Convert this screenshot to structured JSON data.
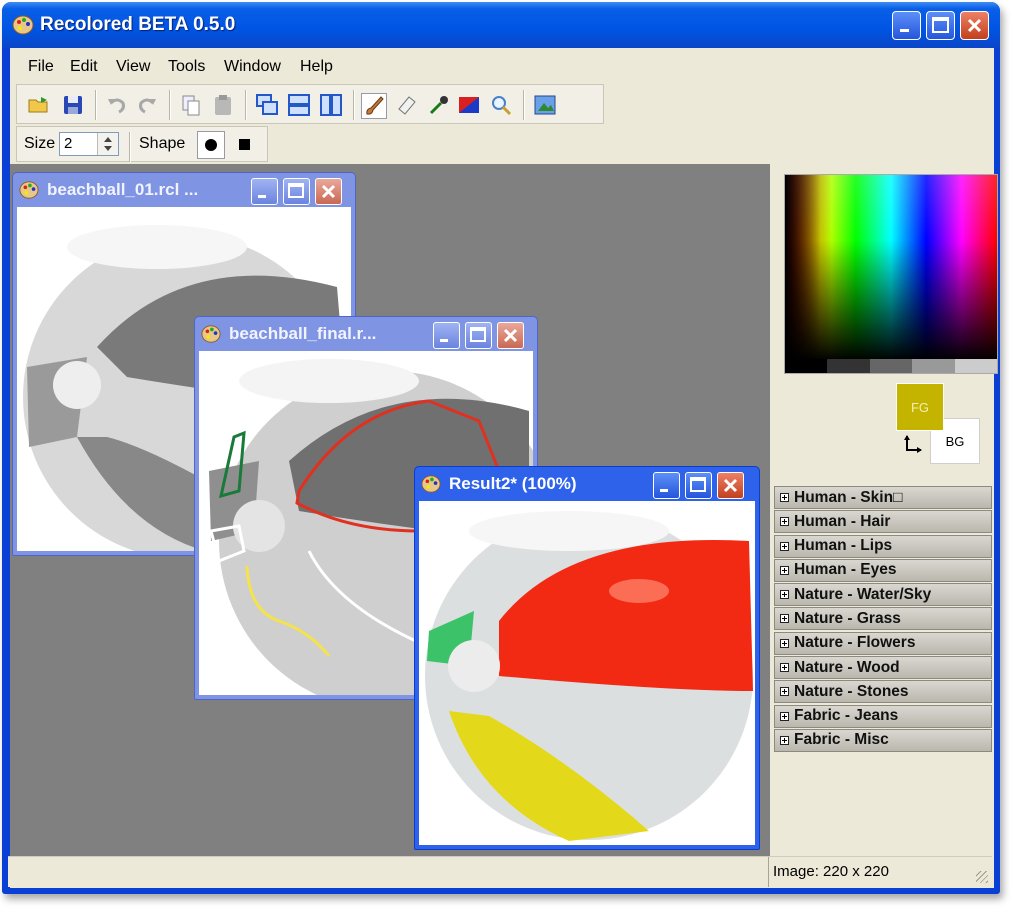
{
  "app": {
    "title": "Recolored BETA 0.5.0"
  },
  "menu": [
    "File",
    "Edit",
    "View",
    "Tools",
    "Window",
    "Help"
  ],
  "toolbar": {
    "tools": [
      "open-icon",
      "save-icon",
      "undo-icon",
      "redo-icon",
      "copy-icon",
      "paste-icon",
      "cascade-icon",
      "tile-horizontal-icon",
      "tile-vertical-icon",
      "brush-icon",
      "eraser-icon",
      "eyedropper-icon",
      "color-fill-icon",
      "zoom-icon",
      "preview-icon"
    ]
  },
  "options": {
    "size_label": "Size",
    "size_value": "2",
    "shape_label": "Shape"
  },
  "windows": {
    "w1": {
      "title": "beachball_01.rcl ..."
    },
    "w2": {
      "title": "beachball_final.r..."
    },
    "w3": {
      "title": "Result2* (100%)"
    }
  },
  "colors": {
    "fg_label": "FG",
    "bg_label": "BG",
    "fg": "#c4b400",
    "bg": "#ffffff"
  },
  "palettes": [
    "Human - Skin□",
    "Human - Hair",
    "Human - Lips",
    "Human - Eyes",
    "Nature - Water/Sky",
    "Nature - Grass",
    "Nature - Flowers",
    "Nature - Wood",
    "Nature - Stones",
    "Fabric - Jeans",
    "Fabric - Misc"
  ],
  "status": {
    "image_size": "Image: 220 x 220"
  }
}
